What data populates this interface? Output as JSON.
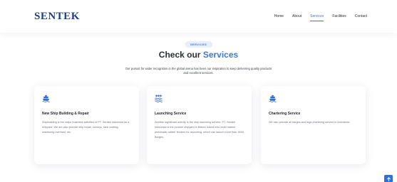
{
  "brand": {
    "logo_text": "SENTEK",
    "color": "#1d3f86"
  },
  "nav": {
    "items": [
      "Home",
      "About",
      "Services",
      "Facilities",
      "Contact"
    ],
    "active_index": 2,
    "accent_color": "#3f78d8"
  },
  "section": {
    "tag": "SERVICES",
    "title_prefix": "Check our ",
    "title_accent": "Services",
    "description": "Our pursuit for wider recognition in the global arena has been our inspiration to keep delivering quality products and excellent services."
  },
  "cards": [
    {
      "icon": "ship-icon",
      "title": "New Ship Building & Repair",
      "text": "Shipbuilding is the major business activities of PT. Sentek Indonesia as a shipyard. We are also provide ship repair, surveys, tank coating, machining overhaul, etc."
    },
    {
      "icon": "waves-icon",
      "title": "Launching Service",
      "text": "Another significant activity is the ship launching service. PT. Sentek Indonesia is the pioneer shipyard in Batam Island who insist marine pneumatic rubber fenders for launching, which can launch more than 3000 Barges."
    },
    {
      "icon": "ship-icon",
      "title": "Chartering Service",
      "text": "We also provide all barges and tugs chartering service in Indonesia."
    }
  ],
  "back_to_top": {
    "icon": "arrow-up-icon"
  }
}
